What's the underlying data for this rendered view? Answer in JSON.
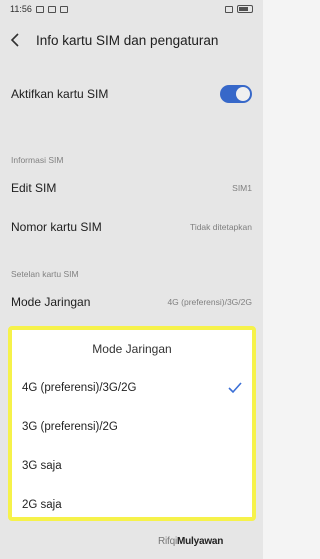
{
  "status": {
    "time": "11:56"
  },
  "header": {
    "title": "Info kartu SIM dan pengaturan"
  },
  "activate": {
    "label": "Aktifkan kartu SIM",
    "enabled": true
  },
  "info_section": {
    "title": "Informasi SIM"
  },
  "edit_sim": {
    "label": "Edit SIM",
    "value": "SIM1"
  },
  "sim_number": {
    "label": "Nomor kartu SIM",
    "value": "Tidak ditetapkan"
  },
  "settings_section": {
    "title": "Setelan kartu SIM"
  },
  "network_mode": {
    "label": "Mode Jaringan",
    "value": "4G (preferensi)/3G/2G"
  },
  "dialog": {
    "title": "Mode Jaringan",
    "options": [
      "4G (preferensi)/3G/2G",
      "3G (preferensi)/2G",
      "3G saja",
      "2G saja"
    ],
    "selected_index": 0
  },
  "watermark": {
    "part1": "Rifqi",
    "part2": "Mulyawan"
  },
  "colors": {
    "accent": "#3b6fd6",
    "highlight": "#f6f24a"
  }
}
